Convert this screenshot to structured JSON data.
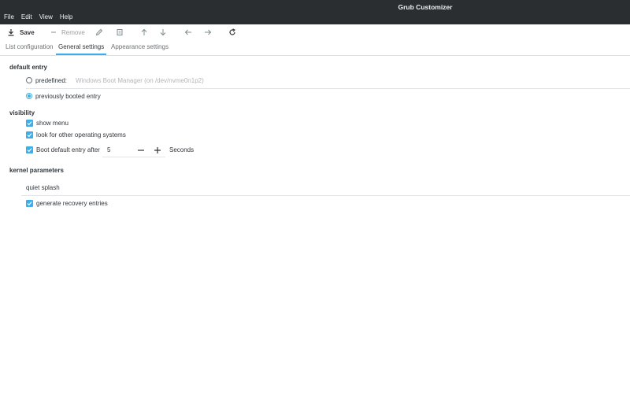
{
  "window": {
    "title": "Grub Customizer"
  },
  "menu": [
    "File",
    "Edit",
    "View",
    "Help"
  ],
  "toolbar": {
    "save_label": "Save",
    "remove_label": "Remove"
  },
  "tabs": [
    "List configuration",
    "General settings",
    "Appearance settings"
  ],
  "active_tab": "General settings",
  "default_entry": {
    "title": "default entry",
    "predefined_label": "predefined:",
    "predefined_value": "Windows Boot Manager (on /dev/nvme0n1p2)",
    "previously_booted_label": "previously booted entry",
    "selected": "previously booted entry"
  },
  "visibility": {
    "title": "visibility",
    "show_menu_label": "show menu",
    "look_for_other_os_label": "look for other operating systems",
    "boot_default_after_label": "Boot default entry after",
    "timeout_value": "5",
    "seconds_label": "Seconds"
  },
  "kernel_parameters": {
    "title": "kernel parameters",
    "value": "quiet splash",
    "generate_recovery_label": "generate recovery entries"
  },
  "colors": {
    "accent": "#3daee9",
    "titlebar": "#2b2e31"
  }
}
